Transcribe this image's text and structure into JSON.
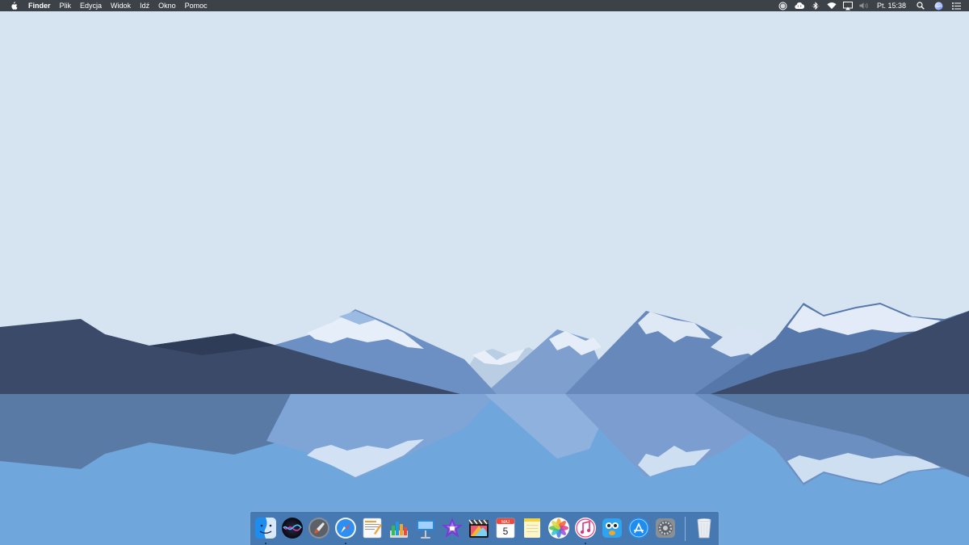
{
  "menubar": {
    "apple_icon": "apple-logo-icon",
    "app_name": "Finder",
    "menus": [
      "Plik",
      "Edycja",
      "Widok",
      "Idź",
      "Okno",
      "Pomoc"
    ],
    "status_icons": [
      "record-icon",
      "creative-cloud-icon",
      "bluetooth-icon",
      "wifi-icon",
      "airplay-icon",
      "volume-icon"
    ],
    "clock": "Pt. 15:38",
    "extra_icons": [
      "spotlight-search-icon",
      "siri-icon",
      "notification-center-icon"
    ]
  },
  "desktop": {
    "sky_color": "#d6e3f0",
    "water_color": "#6fa7dd"
  },
  "dock": {
    "apps": [
      {
        "name": "Finder",
        "icon": "finder-icon",
        "running": true
      },
      {
        "name": "Siri",
        "icon": "siri-icon",
        "running": false
      },
      {
        "name": "Launchpad",
        "icon": "launchpad-icon",
        "running": false
      },
      {
        "name": "Safari",
        "icon": "safari-icon",
        "running": true
      },
      {
        "name": "Pages",
        "icon": "pages-icon",
        "running": false
      },
      {
        "name": "Numbers",
        "icon": "numbers-icon",
        "running": false
      },
      {
        "name": "Keynote",
        "icon": "keynote-icon",
        "running": false
      },
      {
        "name": "iMovie",
        "icon": "imovie-icon",
        "running": false
      },
      {
        "name": "Final Cut Pro",
        "icon": "final-cut-pro-icon",
        "running": false
      },
      {
        "name": "Kalendarz",
        "icon": "calendar-icon",
        "running": false,
        "month": "MAJ",
        "day": "5"
      },
      {
        "name": "Notatki",
        "icon": "notes-icon",
        "running": false
      },
      {
        "name": "Zdjęcia",
        "icon": "photos-icon",
        "running": false
      },
      {
        "name": "iTunes",
        "icon": "itunes-icon",
        "running": true
      },
      {
        "name": "Tweetbot",
        "icon": "tweetbot-icon",
        "running": false
      },
      {
        "name": "App Store",
        "icon": "app-store-icon",
        "running": false
      },
      {
        "name": "Preferencje systemowe",
        "icon": "system-preferences-icon",
        "running": false
      }
    ],
    "trash": {
      "name": "Kosz",
      "icon": "trash-icon"
    }
  }
}
